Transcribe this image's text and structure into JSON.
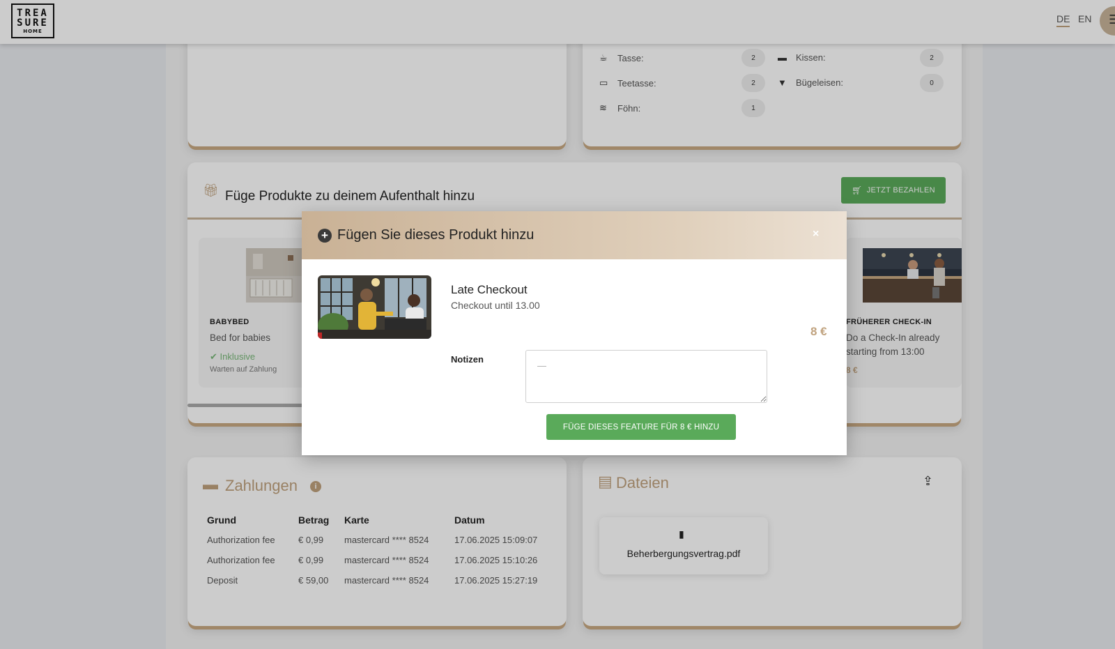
{
  "header": {
    "logo_line1": "TREA",
    "logo_line2": "SURE",
    "logo_line3": "HOME",
    "lang_de": "DE",
    "lang_en": "EN",
    "menu_icon": "hamburger-icon"
  },
  "amenities": [
    {
      "icon": "mug-icon",
      "label": "Tasse:",
      "count": "2"
    },
    {
      "icon": "teacup-icon",
      "label": "Teetasse:",
      "count": "2"
    },
    {
      "icon": "hairdryer-icon",
      "label": "Föhn:",
      "count": "1"
    },
    {
      "icon": "bed-icon",
      "label": "Kissen:",
      "count": "2"
    },
    {
      "icon": "shirt-icon",
      "label": "Bügeleisen:",
      "count": "0"
    }
  ],
  "products": {
    "title": "Füge Produkte zu deinem Aufenthalt hinzu",
    "pay_button": "JETZT BEZAHLEN",
    "items": [
      {
        "category": "BABYBED",
        "description": "Bed for babies",
        "included": "Inklusive",
        "status": "Warten auf Zahlung"
      },
      {
        "category": "FRÜHERER CHECK-IN",
        "description_line1": "Do a Check-In already",
        "description_line2": "starting from 13:00",
        "price": "8 €"
      }
    ]
  },
  "modal": {
    "title": "Fügen Sie dieses Produkt hinzu",
    "close": "×",
    "product_name": "Late Checkout",
    "product_sub": "Checkout until 13.00",
    "price": "8 €",
    "notes_label": "Notizen",
    "notes_placeholder": "—",
    "add_button": "FÜGE DIESES FEATURE FÜR 8 € HINZU"
  },
  "payments": {
    "title": "Zahlungen",
    "columns": [
      "Grund",
      "Betrag",
      "Karte",
      "Datum"
    ],
    "rows": [
      [
        "Authorization fee",
        "€ 0,99",
        "mastercard **** 8524",
        "17.06.2025 15:09:07"
      ],
      [
        "Authorization fee",
        "€ 0,99",
        "mastercard **** 8524",
        "17.06.2025 15:10:26"
      ],
      [
        "Deposit",
        "€ 59,00",
        "mastercard **** 8524",
        "17.06.2025 15:27:19"
      ]
    ]
  },
  "files": {
    "title": "Dateien",
    "items": [
      "Beherbergungsvertrag.pdf"
    ]
  },
  "colors": {
    "accent": "#c0a27e",
    "button_green": "#5aaa5a"
  }
}
